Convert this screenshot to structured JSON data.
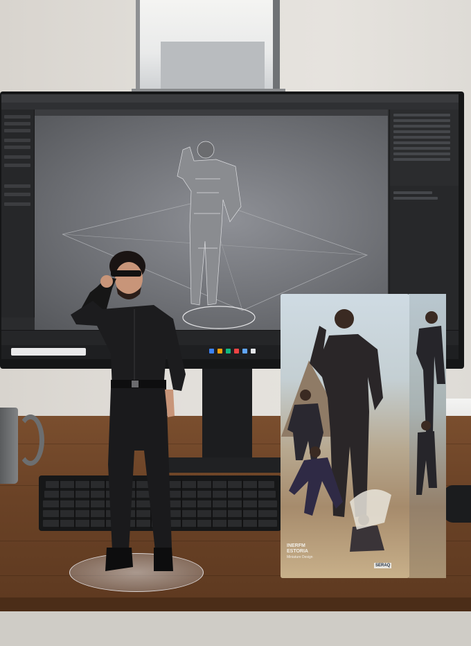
{
  "scene": {
    "monitor": {
      "app_title": "",
      "search_placeholder": ""
    },
    "box": {
      "title_lines": [
        "INERFM",
        "ESTORIA",
        "Miniature Design"
      ],
      "logo": "SERAQ"
    }
  }
}
